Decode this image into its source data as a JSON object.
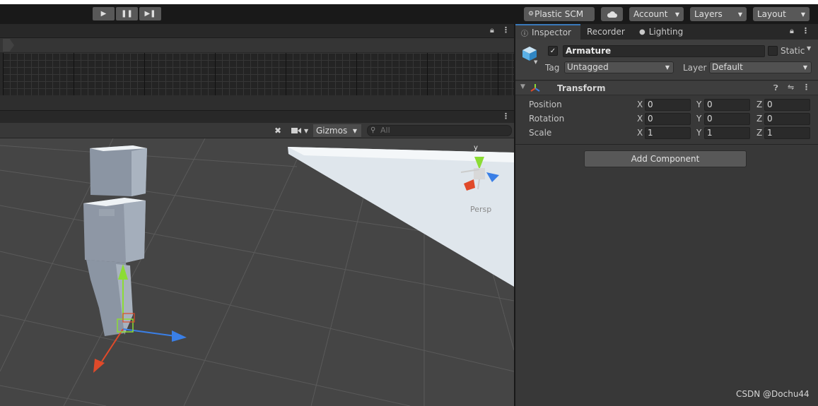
{
  "toolbar": {
    "play_icon": "play-icon",
    "pause_icon": "pause-icon",
    "step_icon": "step-icon",
    "plastic_scm": "Plastic SCM",
    "account": "Account",
    "layers": "Layers",
    "layout": "Layout"
  },
  "scene": {
    "gizmos": "Gizmos",
    "search_placeholder": "All",
    "persp_label": "Persp",
    "axis_y": "y"
  },
  "inspector": {
    "tabs": [
      {
        "label": "Inspector"
      },
      {
        "label": "Recorder"
      },
      {
        "label": "Lighting"
      }
    ],
    "object_name": "Armature",
    "static_label": "Static",
    "tag_label": "Tag",
    "tag_value": "Untagged",
    "layer_label": "Layer",
    "layer_value": "Default",
    "component_title": "Transform",
    "position": {
      "label": "Position",
      "x": "0",
      "y": "0",
      "z": "0"
    },
    "rotation": {
      "label": "Rotation",
      "x": "0",
      "y": "0",
      "z": "0"
    },
    "scale": {
      "label": "Scale",
      "x": "1",
      "y": "1",
      "z": "1"
    },
    "axis_x": "X",
    "axis_y": "Y",
    "axis_z": "Z",
    "add_component": "Add Component"
  },
  "watermark": "CSDN @Dochu44",
  "colors": {
    "accent_tab": "#3a79bb",
    "panel": "#383838",
    "viewport": "#454545"
  }
}
